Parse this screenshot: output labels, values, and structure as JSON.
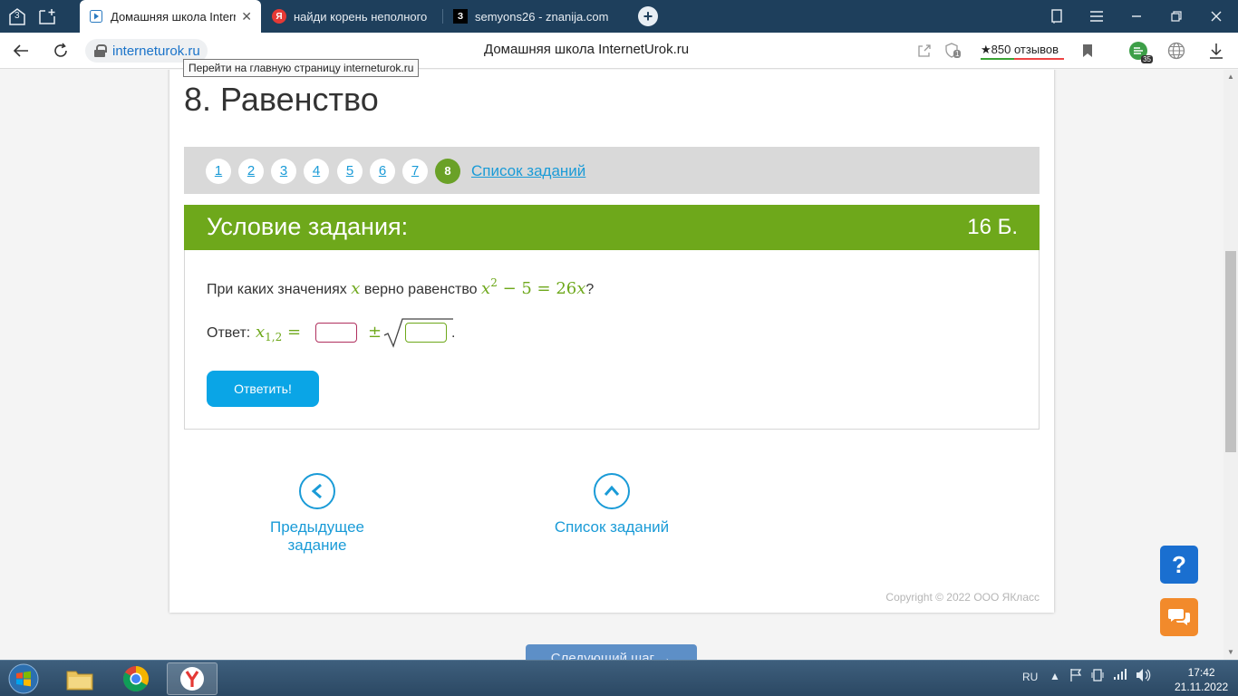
{
  "browser": {
    "tab_counter": "3",
    "tabs": [
      {
        "title": "Домашняя школа Interr",
        "active": true
      },
      {
        "title": "найди корень неполного",
        "active": false
      },
      {
        "title": "semyons26 - znanija.com",
        "active": false
      }
    ],
    "domain": "interneturok.ru",
    "page_title": "Домашняя школа InternetUrok.ru",
    "reviews": "★850 отзывов",
    "shield_badge": "1",
    "ext_badge": "35",
    "tooltip": "Перейти на главную страницу interneturok.ru"
  },
  "page": {
    "heading": "8. Равенство",
    "pager": {
      "items": [
        "1",
        "2",
        "3",
        "4",
        "5",
        "6",
        "7",
        "8"
      ],
      "current": "8",
      "list_link": "Список заданий"
    },
    "task": {
      "header": "Условие задания:",
      "points": "16 Б.",
      "question_text": "При каких значениях",
      "question_var": "x",
      "question_mid": "верно равенство",
      "equation": {
        "base": "x",
        "exp": "2",
        "rest": "− 5 = 26",
        "var": "x"
      },
      "question_end": "?",
      "answer_label": "Ответ:",
      "answer_var": "x",
      "answer_sub": "1,2",
      "answer_eq": "=",
      "plus_minus": "±",
      "dot": ".",
      "inputs": [
        {
          "value": ""
        },
        {
          "value": ""
        }
      ],
      "submit": "Ответить!"
    },
    "nav": {
      "prev": "Предыдущее задание",
      "list": "Список заданий"
    },
    "copyright": "Copyright © 2022 ООО ЯКласс",
    "next_step": "Следующий шаг →",
    "help": "?"
  },
  "taskbar": {
    "lang": "RU",
    "time": "17:42",
    "date": "21.11.2022"
  },
  "colors": {
    "accent_green": "#6ea81b",
    "link_blue": "#1a9bd7",
    "button_blue": "#0aa5e6",
    "help_blue": "#1a6fd0",
    "chat_orange": "#f28a2b",
    "tabbar": "#1e3f5c"
  }
}
